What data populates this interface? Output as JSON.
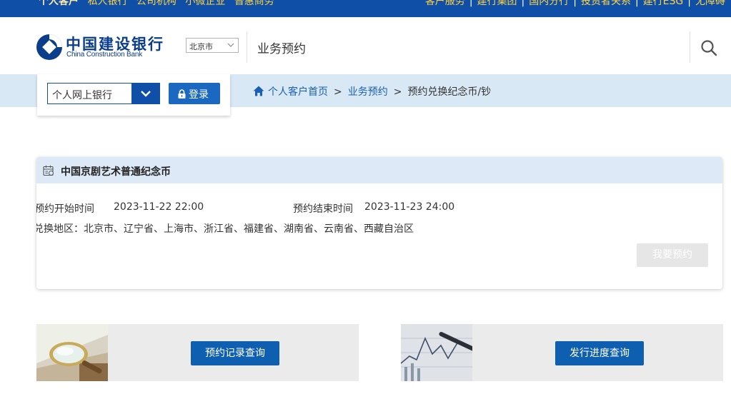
{
  "topbar": {
    "nav": [
      "个人客户",
      "私人银行",
      "公司机构",
      "小微企业",
      "普惠商务"
    ],
    "right": [
      "客户服务",
      "建行集团",
      "国内分行",
      "投资者关系",
      "建行ESG",
      "无障碍"
    ],
    "separator": "|"
  },
  "header": {
    "logo_cn": "中国建设银行",
    "logo_en": "China Construction Bank",
    "city": "北京市",
    "section_title": "业务预约"
  },
  "login": {
    "bank_select": "个人网上银行",
    "login_label": "登录"
  },
  "breadcrumb": {
    "home": "个人客户首页",
    "level1": "业务预约",
    "current": "预约兑换纪念币/钞",
    "separator": ">"
  },
  "card": {
    "title": "中国京剧艺术普通纪念币",
    "start_label": "预约开始时间",
    "start_value": "2023-11-22 22:00",
    "end_label": "预约结束时间",
    "end_value": "2023-11-23 24:00",
    "region_label": "兑换地区：",
    "regions": "北京市、辽宁省、上海市、浙江省、福建省、湖南省、云南省、西藏自治区",
    "book_button": "我要预约"
  },
  "tiles": {
    "left_button": "预约记录查询",
    "right_button": "发行进度查询"
  },
  "colors": {
    "brand_blue": "#0f4fa8",
    "accent_yellow": "#ffd23f",
    "band": "#d9e8f5",
    "button_blue": "#0f5fb0"
  }
}
